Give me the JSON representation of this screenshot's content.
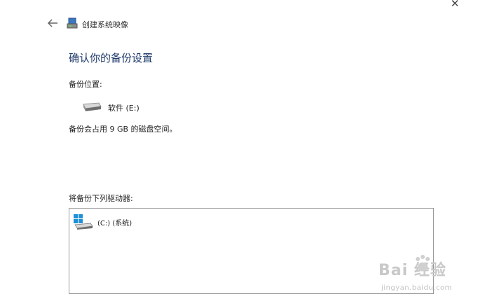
{
  "window": {
    "close_symbol": "✕",
    "back_icon": "back-arrow-icon",
    "app_icon": "system-image-backup-icon",
    "title": "创建系统映像"
  },
  "main": {
    "heading": "确认你的备份设置",
    "backup_location_label": "备份位置:",
    "backup_drive": {
      "icon": "drive-icon",
      "name": "软件 (E:)"
    },
    "space_text": "备份会占用 9 GB 的磁盘空间。",
    "drives_label": "将备份下列驱动器:",
    "drives": [
      {
        "icon": "windows-drive-icon",
        "label": "(C:) (系统)"
      }
    ]
  },
  "watermark": {
    "brand": "Bai  经验",
    "url": "jingyan.baidu.com"
  },
  "colors": {
    "heading": "#1f3a6b",
    "border": "#9a9a9a",
    "windows_blue": "#1e90d6"
  }
}
